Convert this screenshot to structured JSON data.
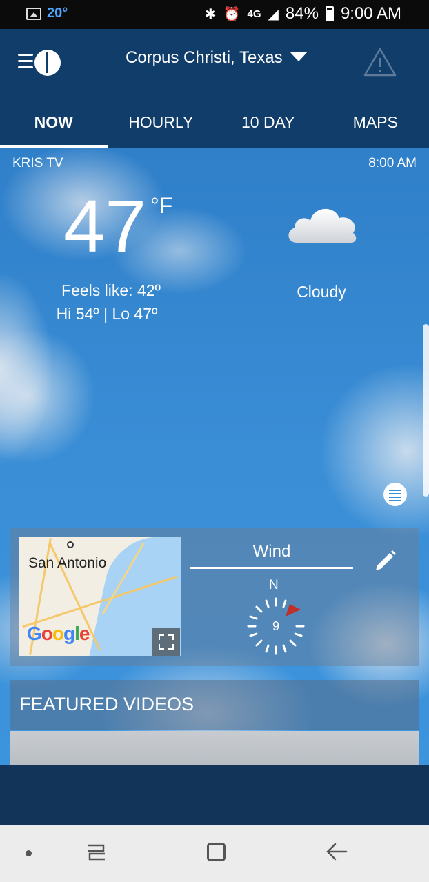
{
  "status_bar": {
    "weather_temp": "20°",
    "network": "4G",
    "battery": "84%",
    "time": "9:00 AM"
  },
  "header": {
    "location": "Corpus Christi, Texas"
  },
  "tabs": [
    {
      "label": "NOW",
      "active": true
    },
    {
      "label": "HOURLY",
      "active": false
    },
    {
      "label": "10 DAY",
      "active": false
    },
    {
      "label": "MAPS",
      "active": false
    }
  ],
  "current": {
    "source": "KRIS TV",
    "observed_time": "8:00 AM",
    "temperature": "47",
    "unit": "°F",
    "feels_like": "Feels like: 42º",
    "hi_lo": "Hi 54º | Lo 47º",
    "condition": "Cloudy",
    "condition_icon": "cloud-icon"
  },
  "map_card": {
    "city_label": "San Antonio",
    "attribution": "Google"
  },
  "wind_card": {
    "title": "Wind",
    "direction_label": "N",
    "speed": "9"
  },
  "featured": {
    "title": "FEATURED VIDEOS"
  },
  "colors": {
    "header_bg": "#113d6a",
    "sky": "#3a8ed6",
    "wind_arrow": "#c0302b"
  }
}
